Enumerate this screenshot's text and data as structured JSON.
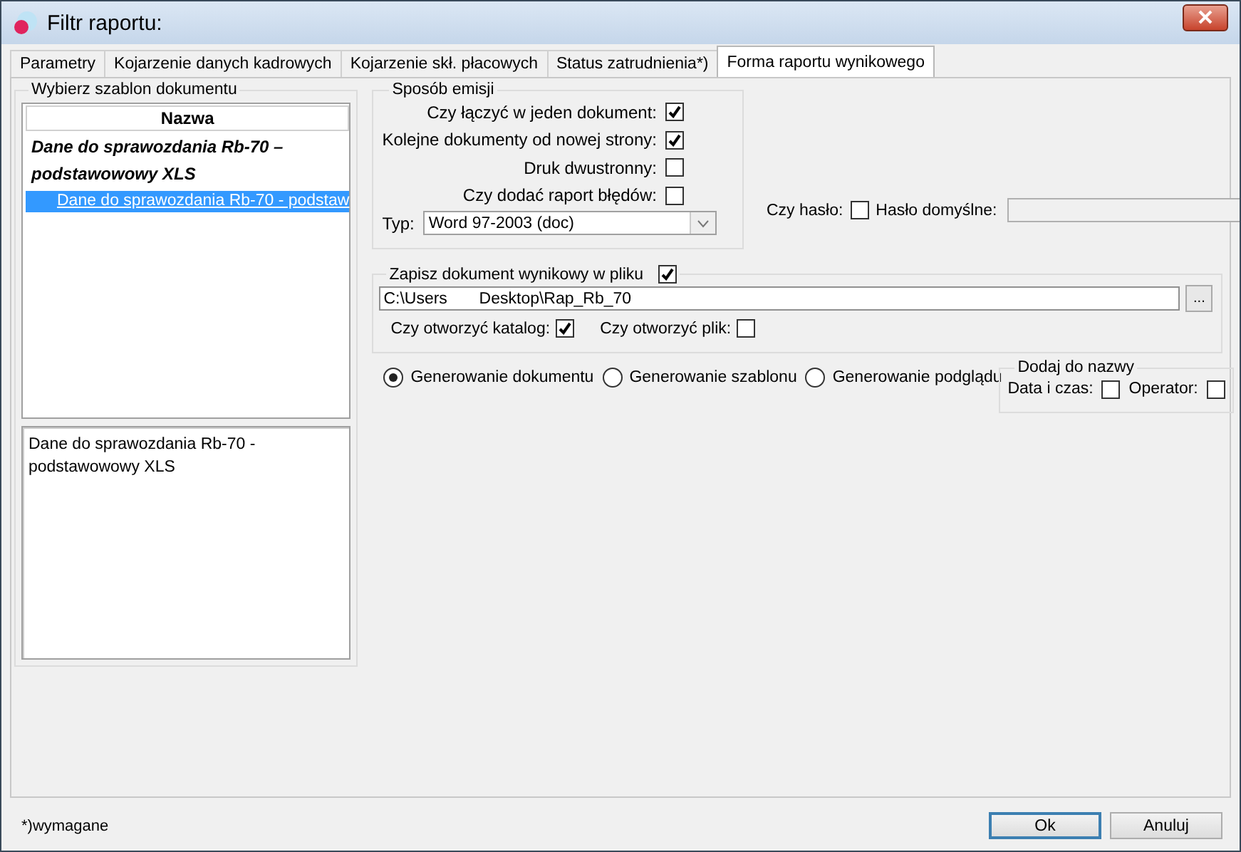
{
  "window": {
    "title": "Filtr raportu:"
  },
  "tabs": [
    {
      "label": "Parametry",
      "selected": false
    },
    {
      "label": "Kojarzenie danych kadrowych",
      "selected": false
    },
    {
      "label": "Kojarzenie skł. płacowych",
      "selected": false
    },
    {
      "label": "Status zatrudnienia*)",
      "selected": false
    },
    {
      "label": "Forma raportu wynikowego",
      "selected": true
    }
  ],
  "template_panel": {
    "title": "Wybierz szablon dokumentu",
    "columns": [
      "Nazwa"
    ],
    "rows": [
      {
        "kind": "group",
        "text": "Dane do sprawozdania Rb-70 – podstawowowy XLS",
        "selected": false
      },
      {
        "kind": "item",
        "text": "Dane do sprawozdania Rb-70 - podstaw",
        "selected": true
      }
    ],
    "description": "Dane do sprawozdania Rb-70 - podstawowowy XLS"
  },
  "emission": {
    "title": "Sposób emisji",
    "options": [
      {
        "label": "Czy łączyć w jeden dokument:",
        "checked": true
      },
      {
        "label": "Kolejne dokumenty od nowej strony:",
        "checked": true
      },
      {
        "label": "Druk dwustronny:",
        "checked": false
      },
      {
        "label": "Czy dodać raport błędów:",
        "checked": false
      }
    ],
    "type_label": "Typ:",
    "type_value": "Word 97-2003 (doc)"
  },
  "password": {
    "label": "Czy hasło:",
    "checked": false,
    "default_label": "Hasło domyślne:"
  },
  "save_file": {
    "label": "Zapisz dokument wynikowy w pliku",
    "checked": true,
    "path": "C:\\Users       Desktop\\Rap_Rb_70",
    "browse": "...",
    "open_folder": {
      "label": "Czy otworzyć katalog:",
      "checked": true
    },
    "open_file": {
      "label": "Czy otworzyć plik:",
      "checked": false
    }
  },
  "generation": [
    {
      "label": "Generowanie dokumentu",
      "selected": true
    },
    {
      "label": "Generowanie szablonu",
      "selected": false
    },
    {
      "label": "Generowanie podglądu",
      "selected": false
    }
  ],
  "add_to_name": {
    "title": "Dodaj do nazwy",
    "options": [
      {
        "label": "Data i czas:",
        "checked": false
      },
      {
        "label": "Operator:",
        "checked": false
      }
    ]
  },
  "footer": {
    "note": "*)wymagane",
    "buttons": [
      {
        "label": "Ok",
        "default": true
      },
      {
        "label": "Anuluj",
        "default": false
      }
    ]
  }
}
